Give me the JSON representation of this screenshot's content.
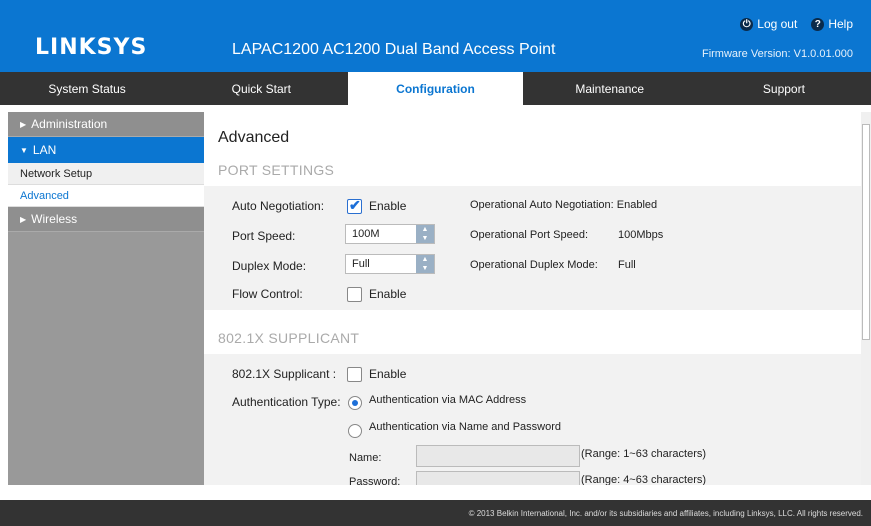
{
  "header": {
    "brand": "LINKSYS",
    "product_title": "LAPAC1200 AC1200 Dual Band Access Point",
    "logout_label": "Log out",
    "help_label": "Help",
    "firmware": "Firmware Version: V1.0.01.000",
    "bg_color": "#0b76d1"
  },
  "nav": {
    "tabs": [
      "System Status",
      "Quick Start",
      "Configuration",
      "Maintenance",
      "Support"
    ],
    "active": "Configuration"
  },
  "sidebar": {
    "administration": "Administration",
    "lan": "LAN",
    "network_setup": "Network Setup",
    "advanced": "Advanced",
    "wireless": "Wireless"
  },
  "page": {
    "title": "Advanced",
    "port_settings_title": "PORT SETTINGS",
    "auto_negotiation_label": "Auto Negotiation:",
    "auto_negotiation_enable": "Enable",
    "auto_negotiation_checked": true,
    "op_auto_neg": "Operational Auto Negotiation: Enabled",
    "port_speed_label": "Port Speed:",
    "port_speed_value": "100M",
    "op_port_speed_label": "Operational Port Speed:",
    "op_port_speed_value": "100Mbps",
    "duplex_label": "Duplex Mode:",
    "duplex_value": "Full",
    "op_duplex_label": "Operational Duplex Mode:",
    "op_duplex_value": "Full",
    "flow_control_label": "Flow Control:",
    "flow_control_enable": "Enable",
    "flow_control_checked": false,
    "supplicant_title": "802.1X SUPPLICANT",
    "supplicant_label": "802.1X Supplicant :",
    "supplicant_enable": "Enable",
    "supplicant_checked": false,
    "auth_type_label": "Authentication Type:",
    "auth_mac": "Authentication via MAC Address",
    "auth_name_pw": "Authentication via Name and Password",
    "auth_selected": "mac",
    "name_label": "Name:",
    "name_value": "",
    "name_range": "(Range: 1~63 characters)",
    "password_label": "Password:",
    "password_value": "",
    "password_range": "(Range: 4~63 characters)"
  },
  "footer": {
    "copyright": "© 2013 Belkin International, Inc. and/or its subsidiaries and affiliates, including Linksys, LLC. All rights reserved."
  }
}
